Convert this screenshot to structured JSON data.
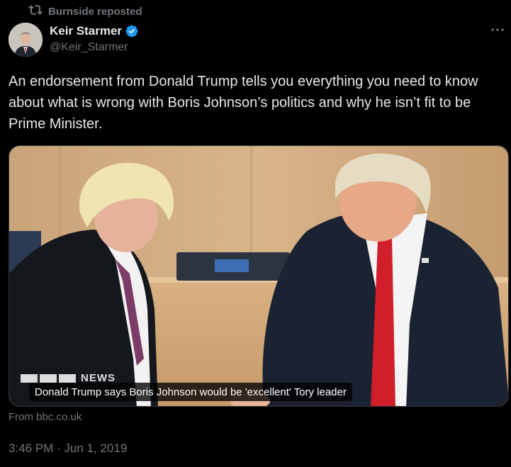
{
  "repost": {
    "label": "Burnside reposted",
    "icon": "repost-icon"
  },
  "author": {
    "name": "Keir Starmer",
    "handle": "@Keir_Starmer",
    "verified": true,
    "verified_color": "#1d9bf0"
  },
  "tweet": {
    "text": "An endorsement from Donald Trump tells you everything you need to know about what is wrong with Boris Johnson’s politics and why he isn’t fit to be Prime Minister."
  },
  "media": {
    "caption": "Donald Trump says Boris Johnson would be 'excellent' Tory leader",
    "logo_text": "NEWS"
  },
  "card": {
    "source": "From bbc.co.uk"
  },
  "meta": {
    "timestamp": "3:46 PM · Jun 1, 2019"
  },
  "colors": {
    "background": "#000000",
    "text": "#e7e9ea",
    "muted": "#71767b",
    "border": "#2f3336"
  }
}
